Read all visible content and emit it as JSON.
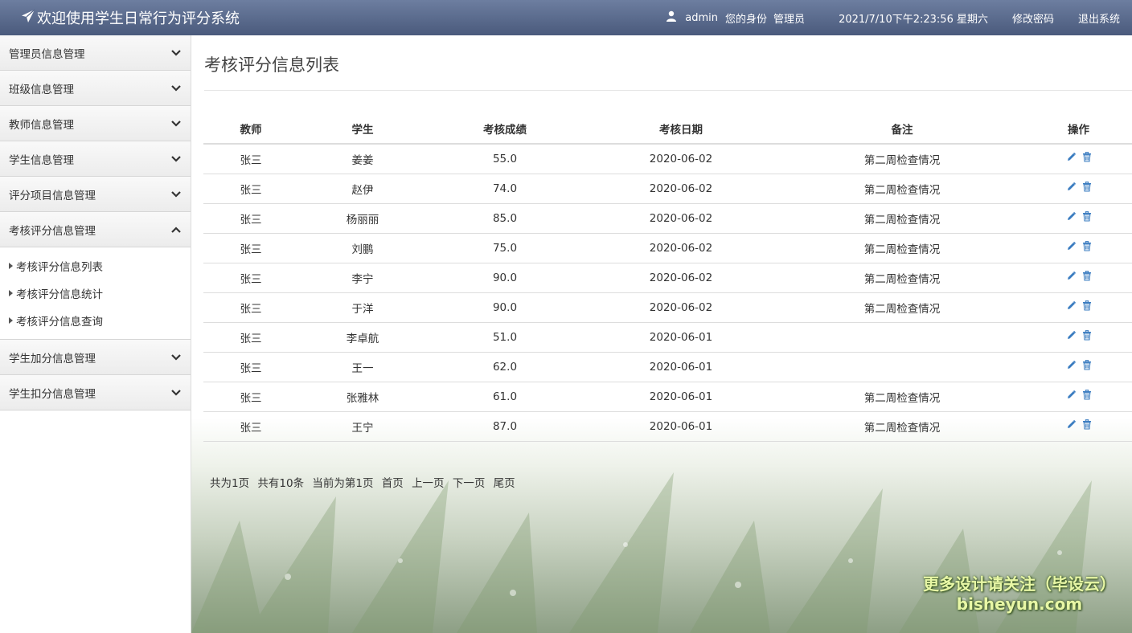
{
  "header": {
    "title": "欢迎使用学生日常行为评分系统",
    "user": "admin",
    "role_label": "您的身份",
    "role": "管理员",
    "datetime": "2021/7/10下午2:23:56 星期六",
    "change_password": "修改密码",
    "logout": "退出系统"
  },
  "sidebar": {
    "groups": [
      {
        "label": "管理员信息管理",
        "expanded": false
      },
      {
        "label": "班级信息管理",
        "expanded": false
      },
      {
        "label": "教师信息管理",
        "expanded": false
      },
      {
        "label": "学生信息管理",
        "expanded": false
      },
      {
        "label": "评分项目信息管理",
        "expanded": false
      },
      {
        "label": "考核评分信息管理",
        "expanded": true,
        "items": [
          "考核评分信息列表",
          "考核评分信息统计",
          "考核评分信息查询"
        ]
      },
      {
        "label": "学生加分信息管理",
        "expanded": false
      },
      {
        "label": "学生扣分信息管理",
        "expanded": false
      }
    ]
  },
  "main": {
    "title": "考核评分信息列表",
    "columns": [
      "教师",
      "学生",
      "考核成绩",
      "考核日期",
      "备注",
      "操作"
    ],
    "rows": [
      [
        "张三",
        "姜姜",
        "55.0",
        "2020-06-02",
        "第二周检查情况"
      ],
      [
        "张三",
        "赵伊",
        "74.0",
        "2020-06-02",
        "第二周检查情况"
      ],
      [
        "张三",
        "杨丽丽",
        "85.0",
        "2020-06-02",
        "第二周检查情况"
      ],
      [
        "张三",
        "刘鹏",
        "75.0",
        "2020-06-02",
        "第二周检查情况"
      ],
      [
        "张三",
        "李宁",
        "90.0",
        "2020-06-02",
        "第二周检查情况"
      ],
      [
        "张三",
        "于洋",
        "90.0",
        "2020-06-02",
        "第二周检查情况"
      ],
      [
        "张三",
        "李卓航",
        "51.0",
        "2020-06-01",
        ""
      ],
      [
        "张三",
        "王一",
        "62.0",
        "2020-06-01",
        ""
      ],
      [
        "张三",
        "张雅林",
        "61.0",
        "2020-06-01",
        "第二周检查情况"
      ],
      [
        "张三",
        "王宁",
        "87.0",
        "2020-06-01",
        "第二周检查情况"
      ]
    ],
    "pager": {
      "total_pages": "共为1页",
      "total_items": "共有10条",
      "current": "当前为第1页",
      "first": "首页",
      "prev": "上一页",
      "next": "下一页",
      "last": "尾页"
    }
  },
  "watermark": {
    "line1": "更多设计请关注（毕设云）",
    "line2": "bisheyun.com"
  },
  "colors": {
    "header_bg": "#56678a",
    "icon_blue": "#3a7cc0",
    "watermark": "#e8f7a6"
  },
  "icons": {
    "brand": "paper-plane-icon",
    "user": "user-icon",
    "collapsed": "chevron-down-icon",
    "expanded": "chevron-up-icon",
    "edit": "pencil-icon",
    "delete": "trash-icon"
  }
}
